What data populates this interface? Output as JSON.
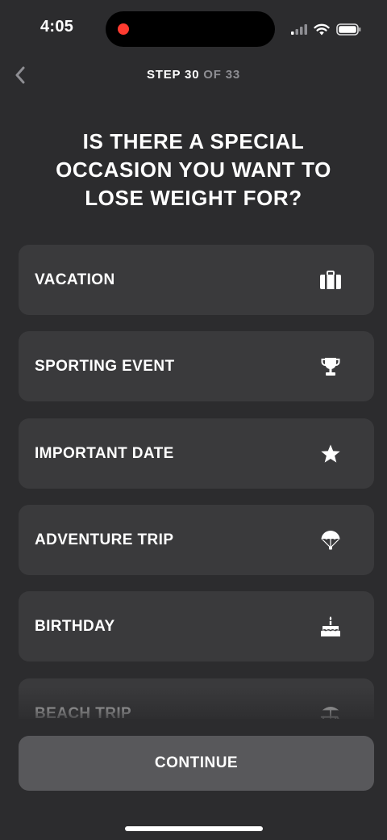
{
  "status_bar": {
    "time": "4:05"
  },
  "header": {
    "back_icon": "chevron-left-icon",
    "step_prefix": "STEP 30",
    "step_suffix": " OF 33"
  },
  "question": {
    "text": "IS THERE A SPECIAL OCCASION YOU WANT TO LOSE WEIGHT FOR?"
  },
  "options": [
    {
      "label": "VACATION",
      "icon": "suitcase-icon"
    },
    {
      "label": "SPORTING EVENT",
      "icon": "trophy-icon"
    },
    {
      "label": "IMPORTANT DATE",
      "icon": "star-icon"
    },
    {
      "label": "ADVENTURE TRIP",
      "icon": "parachute-icon"
    },
    {
      "label": "BIRTHDAY",
      "icon": "cake-icon"
    },
    {
      "label": "BEACH TRIP",
      "icon": "beach-chair-icon"
    }
  ],
  "footer": {
    "continue_label": "CONTINUE"
  },
  "colors": {
    "background": "#2c2c2e",
    "option_background": "#3a3a3c",
    "button_background": "#58585b",
    "muted_text": "#8e8e93",
    "record_dot": "#ff3b30"
  }
}
